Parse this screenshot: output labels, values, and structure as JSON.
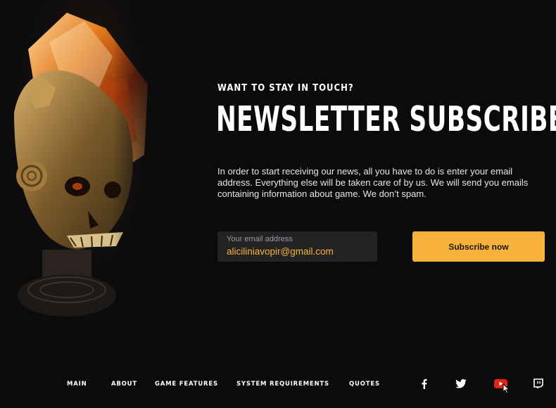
{
  "newsletter": {
    "eyebrow": "WANT TO STAY IN TOUCH?",
    "title": "NEWSLETTER SUBSCRIBE",
    "description": "In order to start receiving our news, all you have to do is enter your email address. Everything else will be taken care of by us. We will send you emails containing information about game. We don’t spam.",
    "email_label": "Your email address",
    "email_value": "aliciliniavopir@gmail.com",
    "button_label": "Subscribe now"
  },
  "footer": {
    "nav": [
      "MAIN",
      "ABOUT",
      "GAME FEATURES",
      "SYSTEM REQUIREMENTS",
      "QUOTES"
    ],
    "social": [
      "facebook-icon",
      "twitter-icon",
      "youtube-icon",
      "twitch-icon"
    ]
  },
  "colors": {
    "background": "#0b0b0d",
    "accent": "#f7b23e",
    "input_bg": "#232326",
    "email_text": "#f5b33a",
    "youtube": "#e62117"
  }
}
